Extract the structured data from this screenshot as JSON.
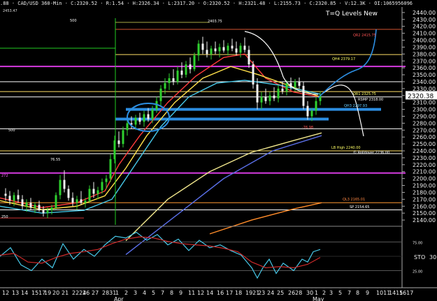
{
  "header": {
    "symbol_line": ".88 · CAD/USD 360-Min · C:2320.52 · R:1.54 · H:2326.34 · L:2317.20 · O:2320.52 · H:2321.48 · L:2155.73 · C:2320.85 · V:12.3K · OI:1065956096",
    "title": "T=Q Levels New",
    "max_value": "2453.47"
  },
  "price_axis": {
    "labels": [
      "2440.00",
      "2430.00",
      "2420.00",
      "2410.00",
      "2400.00",
      "2390.00",
      "2380.00",
      "2370.00",
      "2360.00",
      "2350.00",
      "2340.00",
      "2330.00",
      "2320.00",
      "2310.00",
      "2300.00",
      "2290.00",
      "2280.00",
      "2270.00",
      "2260.00",
      "2250.00",
      "2240.00",
      "2230.00",
      "2220.00",
      "2210.00",
      "2200.00",
      "2190.00",
      "2180.00",
      "2170.00",
      "2160.00",
      "2150.00",
      "2140.00"
    ],
    "last_price": "2320.38"
  },
  "level_labels": [
    {
      "text": "QR2 2415.75",
      "color": "#ff5555"
    },
    {
      "text": "QH4 2379.17",
      "color": "#ffff66"
    },
    {
      "text": "QR1 2325.75",
      "color": "#ffff66"
    },
    {
      "text": "RSMP 2318.00",
      "color": "#ffffff"
    },
    {
      "text": "QH3 2297.93",
      "color": "#66ccff"
    },
    {
      "text": "LB High 2240.00",
      "color": "#ffff66"
    },
    {
      "text": "© Rolldover 2236.00",
      "color": "#ffffff"
    },
    {
      "text": "QL3 2165.01",
      "color": "#ff8844"
    },
    {
      "text": "SP 2154.65",
      "color": "#ffffff"
    },
    {
      "text": "76.55",
      "color": "#ffffff"
    },
    {
      "text": "-76.98",
      "color": "#ff5555"
    },
    {
      "text": "2403.75",
      "color": "#ffffff"
    },
    {
      "text": "500",
      "color": "#ffffff"
    },
    {
      "text": "500",
      "color": "#ffffff"
    },
    {
      "text": "272",
      "color": "#ff66ff"
    },
    {
      "text": "250",
      "color": "#ffffff"
    }
  ],
  "stochastic": {
    "label": "STO",
    "value": "30",
    "levels": [
      "75.00",
      "25.00"
    ]
  },
  "date_axis": {
    "labels": [
      "12",
      "13",
      "14",
      "1517",
      "19",
      "20",
      "21",
      "2224",
      "26",
      "27",
      "2831",
      "1",
      "2",
      "3",
      "4",
      "5",
      "7",
      "8",
      "9",
      "11",
      "12",
      "14",
      "16",
      "17",
      "18",
      "1921",
      "23",
      "24",
      "25",
      "2628",
      "30",
      "1",
      "2",
      "3",
      "5",
      "7",
      "8",
      "9",
      "1011",
      "1415",
      "1617"
    ],
    "months": [
      "Apr",
      "May"
    ]
  },
  "chart_data": {
    "type": "candlestick",
    "title": "T=Q Levels New",
    "ylim": [
      2133,
      2448
    ],
    "sto_ylim": [
      0,
      100
    ],
    "candles": [
      {
        "x": 8,
        "o": 2178,
        "h": 2186,
        "l": 2168,
        "c": 2175
      },
      {
        "x": 14,
        "o": 2175,
        "h": 2182,
        "l": 2162,
        "c": 2168
      },
      {
        "x": 20,
        "o": 2168,
        "h": 2180,
        "l": 2160,
        "c": 2176
      },
      {
        "x": 26,
        "o": 2176,
        "h": 2184,
        "l": 2165,
        "c": 2170
      },
      {
        "x": 32,
        "o": 2170,
        "h": 2176,
        "l": 2155,
        "c": 2160
      },
      {
        "x": 38,
        "o": 2160,
        "h": 2170,
        "l": 2152,
        "c": 2165
      },
      {
        "x": 44,
        "o": 2165,
        "h": 2172,
        "l": 2155,
        "c": 2158
      },
      {
        "x": 50,
        "o": 2158,
        "h": 2166,
        "l": 2150,
        "c": 2162
      },
      {
        "x": 56,
        "o": 2162,
        "h": 2168,
        "l": 2152,
        "c": 2155
      },
      {
        "x": 62,
        "o": 2155,
        "h": 2160,
        "l": 2145,
        "c": 2150
      },
      {
        "x": 68,
        "o": 2150,
        "h": 2158,
        "l": 2143,
        "c": 2154
      },
      {
        "x": 74,
        "o": 2154,
        "h": 2162,
        "l": 2148,
        "c": 2158
      },
      {
        "x": 80,
        "o": 2158,
        "h": 2180,
        "l": 2155,
        "c": 2176
      },
      {
        "x": 86,
        "o": 2176,
        "h": 2205,
        "l": 2170,
        "c": 2198
      },
      {
        "x": 92,
        "o": 2198,
        "h": 2212,
        "l": 2180,
        "c": 2185
      },
      {
        "x": 98,
        "o": 2185,
        "h": 2190,
        "l": 2168,
        "c": 2172
      },
      {
        "x": 104,
        "o": 2172,
        "h": 2180,
        "l": 2160,
        "c": 2165
      },
      {
        "x": 110,
        "o": 2165,
        "h": 2175,
        "l": 2155,
        "c": 2170
      },
      {
        "x": 116,
        "o": 2170,
        "h": 2182,
        "l": 2162,
        "c": 2165
      },
      {
        "x": 122,
        "o": 2165,
        "h": 2172,
        "l": 2158,
        "c": 2168
      },
      {
        "x": 128,
        "o": 2168,
        "h": 2190,
        "l": 2165,
        "c": 2185
      },
      {
        "x": 134,
        "o": 2185,
        "h": 2195,
        "l": 2172,
        "c": 2178
      },
      {
        "x": 140,
        "o": 2178,
        "h": 2188,
        "l": 2170,
        "c": 2183
      },
      {
        "x": 146,
        "o": 2183,
        "h": 2200,
        "l": 2178,
        "c": 2195
      },
      {
        "x": 152,
        "o": 2195,
        "h": 2205,
        "l": 2185,
        "c": 2200
      },
      {
        "x": 158,
        "o": 2200,
        "h": 2235,
        "l": 2195,
        "c": 2228
      },
      {
        "x": 164,
        "o": 2228,
        "h": 2262,
        "l": 2222,
        "c": 2255
      },
      {
        "x": 170,
        "o": 2255,
        "h": 2268,
        "l": 2245,
        "c": 2250
      },
      {
        "x": 176,
        "o": 2250,
        "h": 2275,
        "l": 2245,
        "c": 2270
      },
      {
        "x": 182,
        "o": 2270,
        "h": 2285,
        "l": 2262,
        "c": 2280
      },
      {
        "x": 188,
        "o": 2280,
        "h": 2290,
        "l": 2272,
        "c": 2278
      },
      {
        "x": 194,
        "o": 2278,
        "h": 2292,
        "l": 2270,
        "c": 2288
      },
      {
        "x": 200,
        "o": 2288,
        "h": 2295,
        "l": 2278,
        "c": 2282
      },
      {
        "x": 206,
        "o": 2282,
        "h": 2298,
        "l": 2275,
        "c": 2293
      },
      {
        "x": 212,
        "o": 2293,
        "h": 2302,
        "l": 2282,
        "c": 2286
      },
      {
        "x": 218,
        "o": 2286,
        "h": 2305,
        "l": 2280,
        "c": 2300
      },
      {
        "x": 224,
        "o": 2300,
        "h": 2318,
        "l": 2295,
        "c": 2312
      },
      {
        "x": 230,
        "o": 2312,
        "h": 2335,
        "l": 2305,
        "c": 2330
      },
      {
        "x": 236,
        "o": 2330,
        "h": 2345,
        "l": 2322,
        "c": 2338
      },
      {
        "x": 242,
        "o": 2338,
        "h": 2352,
        "l": 2328,
        "c": 2345
      },
      {
        "x": 248,
        "o": 2345,
        "h": 2358,
        "l": 2335,
        "c": 2340
      },
      {
        "x": 254,
        "o": 2340,
        "h": 2362,
        "l": 2336,
        "c": 2356
      },
      {
        "x": 260,
        "o": 2356,
        "h": 2368,
        "l": 2345,
        "c": 2350
      },
      {
        "x": 266,
        "o": 2350,
        "h": 2370,
        "l": 2346,
        "c": 2365
      },
      {
        "x": 272,
        "o": 2365,
        "h": 2375,
        "l": 2352,
        "c": 2358
      },
      {
        "x": 278,
        "o": 2358,
        "h": 2382,
        "l": 2355,
        "c": 2378
      },
      {
        "x": 284,
        "o": 2378,
        "h": 2400,
        "l": 2370,
        "c": 2395
      },
      {
        "x": 290,
        "o": 2395,
        "h": 2405,
        "l": 2380,
        "c": 2386
      },
      {
        "x": 296,
        "o": 2386,
        "h": 2398,
        "l": 2375,
        "c": 2380
      },
      {
        "x": 302,
        "o": 2380,
        "h": 2392,
        "l": 2372,
        "c": 2388
      },
      {
        "x": 308,
        "o": 2388,
        "h": 2398,
        "l": 2380,
        "c": 2384
      },
      {
        "x": 314,
        "o": 2384,
        "h": 2395,
        "l": 2375,
        "c": 2390
      },
      {
        "x": 320,
        "o": 2390,
        "h": 2400,
        "l": 2382,
        "c": 2385
      },
      {
        "x": 326,
        "o": 2385,
        "h": 2396,
        "l": 2378,
        "c": 2392
      },
      {
        "x": 332,
        "o": 2392,
        "h": 2402,
        "l": 2384,
        "c": 2388
      },
      {
        "x": 338,
        "o": 2388,
        "h": 2398,
        "l": 2378,
        "c": 2382
      },
      {
        "x": 344,
        "o": 2382,
        "h": 2396,
        "l": 2375,
        "c": 2392
      },
      {
        "x": 350,
        "o": 2392,
        "h": 2404,
        "l": 2382,
        "c": 2386
      },
      {
        "x": 356,
        "o": 2386,
        "h": 2392,
        "l": 2360,
        "c": 2365
      },
      {
        "x": 362,
        "o": 2365,
        "h": 2370,
        "l": 2330,
        "c": 2336
      },
      {
        "x": 368,
        "o": 2336,
        "h": 2345,
        "l": 2300,
        "c": 2310
      },
      {
        "x": 374,
        "o": 2310,
        "h": 2325,
        "l": 2300,
        "c": 2318
      },
      {
        "x": 380,
        "o": 2318,
        "h": 2330,
        "l": 2308,
        "c": 2312
      },
      {
        "x": 386,
        "o": 2312,
        "h": 2325,
        "l": 2306,
        "c": 2320
      },
      {
        "x": 392,
        "o": 2320,
        "h": 2332,
        "l": 2312,
        "c": 2316
      },
      {
        "x": 398,
        "o": 2316,
        "h": 2335,
        "l": 2310,
        "c": 2330
      },
      {
        "x": 404,
        "o": 2330,
        "h": 2340,
        "l": 2322,
        "c": 2326
      },
      {
        "x": 410,
        "o": 2326,
        "h": 2342,
        "l": 2320,
        "c": 2338
      },
      {
        "x": 416,
        "o": 2338,
        "h": 2346,
        "l": 2328,
        "c": 2332
      },
      {
        "x": 422,
        "o": 2332,
        "h": 2344,
        "l": 2326,
        "c": 2340
      },
      {
        "x": 428,
        "o": 2340,
        "h": 2346,
        "l": 2330,
        "c": 2334
      },
      {
        "x": 434,
        "o": 2334,
        "h": 2340,
        "l": 2300,
        "c": 2305
      },
      {
        "x": 440,
        "o": 2305,
        "h": 2312,
        "l": 2285,
        "c": 2290
      },
      {
        "x": 446,
        "o": 2290,
        "h": 2302,
        "l": 2283,
        "c": 2298
      },
      {
        "x": 452,
        "o": 2298,
        "h": 2318,
        "l": 2292,
        "c": 2312
      },
      {
        "x": 458,
        "o": 2312,
        "h": 2326,
        "l": 2306,
        "c": 2320
      }
    ],
    "moving_averages": [
      {
        "name": "MA-red",
        "color": "#ff3b3b",
        "points": [
          [
            0,
            2172
          ],
          [
            60,
            2158
          ],
          [
            110,
            2165
          ],
          [
            150,
            2182
          ],
          [
            170,
            2220
          ],
          [
            200,
            2262
          ],
          [
            240,
            2310
          ],
          [
            280,
            2348
          ],
          [
            320,
            2375
          ],
          [
            350,
            2380
          ],
          [
            380,
            2345
          ],
          [
            420,
            2325
          ],
          [
            458,
            2318
          ]
        ]
      },
      {
        "name": "MA-yellow",
        "color": "#ffe04a",
        "points": [
          [
            0,
            2168
          ],
          [
            60,
            2155
          ],
          [
            110,
            2160
          ],
          [
            150,
            2175
          ],
          [
            180,
            2215
          ],
          [
            210,
            2262
          ],
          [
            250,
            2310
          ],
          [
            290,
            2345
          ],
          [
            330,
            2362
          ],
          [
            370,
            2350
          ],
          [
            420,
            2332
          ],
          [
            458,
            2318
          ]
        ]
      },
      {
        "name": "MA-cyan",
        "color": "#47c8e8",
        "points": [
          [
            0,
            2160
          ],
          [
            60,
            2150
          ],
          [
            120,
            2154
          ],
          [
            160,
            2170
          ],
          [
            190,
            2215
          ],
          [
            230,
            2275
          ],
          [
            270,
            2318
          ],
          [
            310,
            2338
          ],
          [
            350,
            2342
          ],
          [
            400,
            2335
          ],
          [
            458,
            2322
          ]
        ]
      },
      {
        "name": "MA-lightyellow",
        "color": "#f0e68c",
        "points": [
          [
            180,
            2110
          ],
          [
            240,
            2170
          ],
          [
            300,
            2210
          ],
          [
            360,
            2238
          ],
          [
            420,
            2255
          ],
          [
            460,
            2266
          ]
        ]
      },
      {
        "name": "MA-blue",
        "color": "#5a6fe8",
        "points": [
          [
            180,
            2090
          ],
          [
            250,
            2145
          ],
          [
            320,
            2200
          ],
          [
            390,
            2240
          ],
          [
            460,
            2262
          ]
        ]
      },
      {
        "name": "MA-orange",
        "color": "#ff8c2a",
        "points": [
          [
            300,
            2120
          ],
          [
            360,
            2140
          ],
          [
            420,
            2156
          ],
          [
            460,
            2165
          ]
        ]
      }
    ],
    "horizontal_levels": [
      {
        "y": 2415.75,
        "color": "#d4552f",
        "x1": 165,
        "x2": 575
      },
      {
        "y": 2379.17,
        "color": "#ffe066",
        "x1": 165,
        "x2": 575
      },
      {
        "y": 2362,
        "color": "#d53adf",
        "x1": 0,
        "x2": 580,
        "w": 2
      },
      {
        "y": 2340,
        "color": "#ffffff",
        "x1": 0,
        "x2": 575
      },
      {
        "y": 2325.75,
        "color": "#ffe066",
        "x1": 0,
        "x2": 575
      },
      {
        "y": 2318,
        "color": "#ffffff",
        "x1": 0,
        "x2": 575
      },
      {
        "y": 2300,
        "color": "#2c8de0",
        "x1": 180,
        "x2": 545,
        "w": 4
      },
      {
        "y": 2286,
        "color": "#2c8de0",
        "x1": 165,
        "x2": 470,
        "w": 4
      },
      {
        "y": 2272,
        "color": "#ffffff",
        "x1": 0,
        "x2": 575
      },
      {
        "y": 2240,
        "color": "#ffe066",
        "x1": 0,
        "x2": 575
      },
      {
        "y": 2236,
        "color": "#ffffff",
        "x1": 0,
        "x2": 575
      },
      {
        "y": 2208,
        "color": "#d53adf",
        "x1": 0,
        "x2": 580,
        "w": 2
      },
      {
        "y": 2165,
        "color": "#ff9933",
        "x1": 0,
        "x2": 575
      },
      {
        "y": 2154.65,
        "color": "#ffffff",
        "x1": 0,
        "x2": 575
      },
      {
        "y": 2143,
        "color": "#cc3333",
        "x1": 0,
        "x2": 120
      }
    ],
    "sto": [
      {
        "name": "%K",
        "color": "#47c8e8",
        "points": [
          [
            0,
            50
          ],
          [
            15,
            65
          ],
          [
            30,
            35
          ],
          [
            45,
            25
          ],
          [
            60,
            45
          ],
          [
            75,
            30
          ],
          [
            90,
            72
          ],
          [
            105,
            45
          ],
          [
            120,
            62
          ],
          [
            135,
            50
          ],
          [
            150,
            70
          ],
          [
            165,
            85
          ],
          [
            180,
            82
          ],
          [
            195,
            92
          ],
          [
            210,
            78
          ],
          [
            225,
            88
          ],
          [
            240,
            70
          ],
          [
            255,
            80
          ],
          [
            270,
            60
          ],
          [
            285,
            78
          ],
          [
            300,
            65
          ],
          [
            315,
            70
          ],
          [
            330,
            60
          ],
          [
            345,
            52
          ],
          [
            360,
            30
          ],
          [
            368,
            12
          ],
          [
            376,
            30
          ],
          [
            385,
            45
          ],
          [
            395,
            20
          ],
          [
            405,
            38
          ],
          [
            420,
            25
          ],
          [
            432,
            45
          ],
          [
            440,
            40
          ],
          [
            448,
            58
          ],
          [
            458,
            62
          ]
        ]
      },
      {
        "name": "%D",
        "color": "#cc2a2a",
        "points": [
          [
            0,
            52
          ],
          [
            20,
            55
          ],
          [
            40,
            40
          ],
          [
            60,
            38
          ],
          [
            80,
            48
          ],
          [
            100,
            55
          ],
          [
            120,
            58
          ],
          [
            140,
            62
          ],
          [
            160,
            72
          ],
          [
            180,
            80
          ],
          [
            200,
            84
          ],
          [
            220,
            82
          ],
          [
            240,
            76
          ],
          [
            260,
            72
          ],
          [
            280,
            70
          ],
          [
            300,
            68
          ],
          [
            320,
            64
          ],
          [
            340,
            58
          ],
          [
            360,
            40
          ],
          [
            380,
            30
          ],
          [
            400,
            32
          ],
          [
            420,
            30
          ],
          [
            440,
            36
          ],
          [
            458,
            48
          ]
        ]
      }
    ]
  }
}
